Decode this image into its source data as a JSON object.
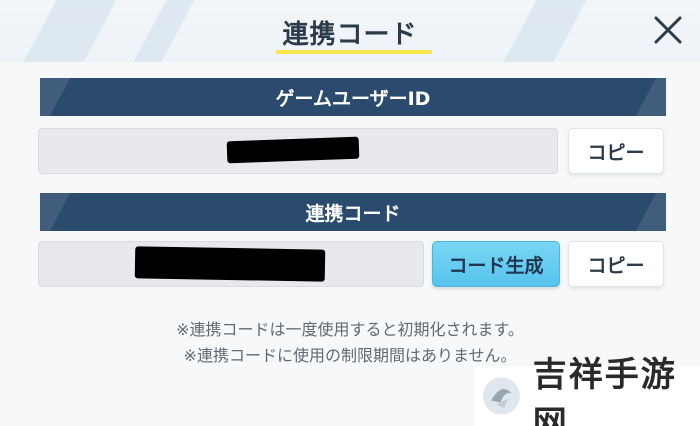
{
  "dialog": {
    "title": "連携コード",
    "close_icon": "close-icon"
  },
  "user_id_section": {
    "heading": "ゲームユーザーID",
    "copy_label": "コピー"
  },
  "link_code_section": {
    "heading": "連携コード",
    "generate_label": "コード生成",
    "copy_label": "コピー"
  },
  "notes": [
    "※連携コードは一度使用すると初期化されます。",
    "※連携コードに使用の制限期間はありません。"
  ],
  "watermark": {
    "text": "吉祥手游网"
  },
  "colors": {
    "section_bar": "#2b4b6e",
    "accent_button": "#56c3ec",
    "title_underline": "#f7e54a"
  }
}
